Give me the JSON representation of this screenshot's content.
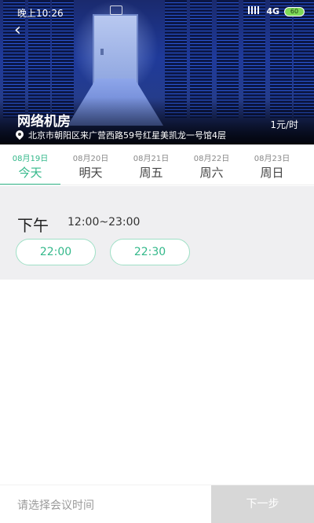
{
  "status_bar": {
    "time": "晚上10:26",
    "network": "4G",
    "battery": "60"
  },
  "venue": {
    "name": "网络机房",
    "price": "1元/时",
    "address": "北京市朝阳区来广营西路59号红星美凯龙一号馆4层"
  },
  "date_tabs": [
    {
      "date": "08月19日",
      "weekday": "今天",
      "active": true
    },
    {
      "date": "08月20日",
      "weekday": "明天",
      "active": false
    },
    {
      "date": "08月21日",
      "weekday": "周五",
      "active": false
    },
    {
      "date": "08月22日",
      "weekday": "周六",
      "active": false
    },
    {
      "date": "08月23日",
      "weekday": "周日",
      "active": false
    }
  ],
  "time_section": {
    "period": "下午",
    "range": "12:00~23:00",
    "slots": [
      "22:00",
      "22:30"
    ]
  },
  "bottom_bar": {
    "hint": "请选择会议时间",
    "next_label": "下一步"
  },
  "colors": {
    "accent": "#33b88a",
    "next_button_disabled": "#d7d7d7",
    "section_bg": "#efeff1"
  },
  "icons": {
    "back": "chevron-left-icon",
    "location": "location-pin-icon"
  }
}
